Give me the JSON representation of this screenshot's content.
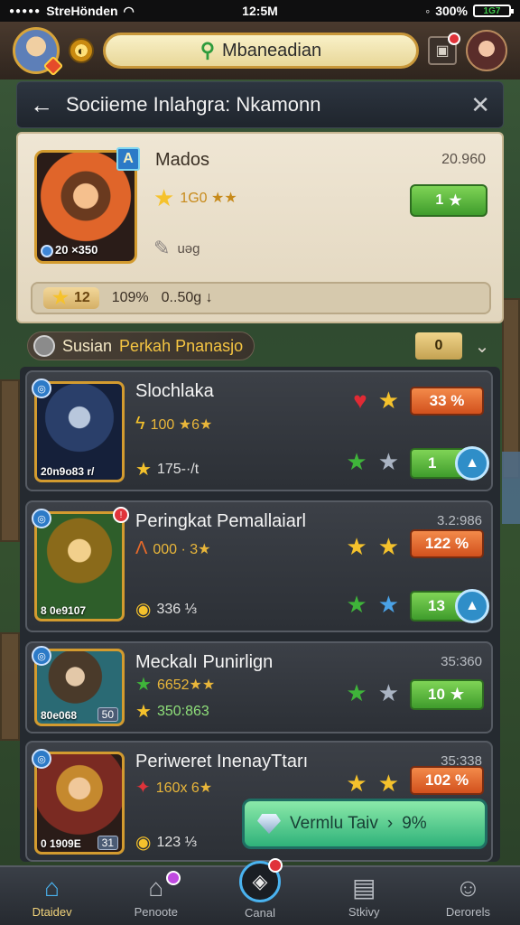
{
  "status_bar": {
    "carrier": "StreHönden",
    "time": "12:5M",
    "battery_pct": "300%",
    "battery_level": "1G7"
  },
  "top_bar": {
    "search_label": "Mbaneadian"
  },
  "header": {
    "title": "Sociieme Inlahgra: Nkamonn"
  },
  "featured": {
    "name": "Mados",
    "value": "20.960",
    "portrait_level": "20 ×350",
    "rank": "1G0 ★★",
    "sub_value": "uəg",
    "button_label": "1",
    "progress_badge": "12",
    "progress_text_a": "109%",
    "progress_text_b": "0..50g ↓"
  },
  "section": {
    "label_a": "Susian",
    "label_b": "Perkah Pnanasjo",
    "count": "0"
  },
  "rows": [
    {
      "name": "Slochlaka",
      "rate": "100 ★6★",
      "stat": "175-·/t",
      "thumb_caption": "20n9o83 r/",
      "pct": "33 %",
      "action": "1",
      "right_val": ""
    },
    {
      "name": "Peringkat Pemallaiarl",
      "rate": "000 · 3★",
      "stat": "336 ⅓",
      "thumb_caption": "8 0e9107",
      "pct": "122 %",
      "action": "13",
      "right_val": "3.2:986"
    },
    {
      "name": "Meckalı Punirlign",
      "rate": "6652★★",
      "stat": "350:863",
      "thumb_caption": "80e068",
      "thumb_badge": "50",
      "pct": "",
      "action": "10",
      "right_val": "35:360"
    },
    {
      "name": "Periweret InenayTtarı",
      "rate": "160x 6★",
      "stat": "123 ⅓",
      "thumb_caption": "0 1909E",
      "thumb_badge": "31",
      "pct": "102 %",
      "action": "",
      "right_val": "35:338"
    }
  ],
  "cta": {
    "label": "Vermlu Taiv",
    "arrow": "›",
    "pct": "9%"
  },
  "bottom_nav": [
    {
      "label": "Dtaidev"
    },
    {
      "label": "Penoote"
    },
    {
      "label": "Canal"
    },
    {
      "label": "Stkivy"
    },
    {
      "label": "Derorels"
    }
  ],
  "colors": {
    "accent_green": "#3f9c2c",
    "accent_orange": "#d2511d",
    "gold": "#f5c22c",
    "panel": "#2c3036"
  },
  "icons": [
    "avatar-icon",
    "coin-icon",
    "search-icon",
    "bag-icon",
    "back-icon",
    "close-icon",
    "star-icon",
    "heart-icon",
    "chevron-down-icon",
    "home-icon",
    "house-icon",
    "badge-icon",
    "story-icon",
    "person-icon"
  ]
}
